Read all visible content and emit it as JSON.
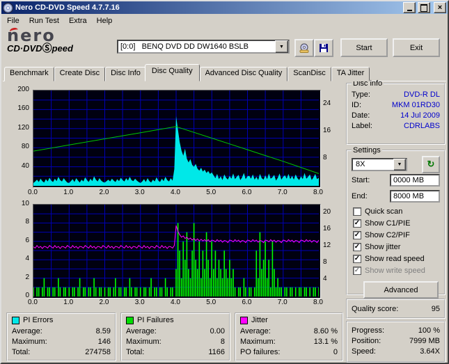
{
  "icons": {
    "close": "×",
    "dropdown": "▼",
    "refresh": "↻",
    "check": "✓"
  },
  "window": {
    "title": "Nero CD-DVD Speed 4.7.7.16"
  },
  "menu": {
    "items": [
      "File",
      "Run Test",
      "Extra",
      "Help"
    ]
  },
  "brand": {
    "logo_top": "nero",
    "logo_bottom_left": "CD·DVD",
    "logo_s": "Ⓢ",
    "logo_bottom_right": "peed"
  },
  "toolbar": {
    "drive": "[0:0]   BENQ DVD DD DW1640 BSLB",
    "start": "Start",
    "exit": "Exit"
  },
  "tabs": {
    "items": [
      "Benchmark",
      "Create Disc",
      "Disc Info",
      "Disc Quality",
      "Advanced Disc Quality",
      "ScanDisc",
      "TA Jitter"
    ],
    "active_index": 3
  },
  "disc_info": {
    "title": "Disc info",
    "rows": [
      {
        "label": "Type:",
        "value": "DVD-R DL"
      },
      {
        "label": "ID:",
        "value": "MKM 01RD30"
      },
      {
        "label": "Date:",
        "value": "14 Jul 2009"
      },
      {
        "label": "Label:",
        "value": "CDRLABS"
      }
    ]
  },
  "settings": {
    "title": "Settings",
    "speed": "8X",
    "start_label": "Start:",
    "start_value": "0000 MB",
    "end_label": "End:",
    "end_value": "8000 MB",
    "checkboxes": [
      {
        "label": "Quick scan",
        "checked": false,
        "enabled": true
      },
      {
        "label": "Show C1/PIE",
        "checked": true,
        "enabled": true
      },
      {
        "label": "Show C2/PIF",
        "checked": true,
        "enabled": true
      },
      {
        "label": "Show jitter",
        "checked": true,
        "enabled": true
      },
      {
        "label": "Show read speed",
        "checked": true,
        "enabled": true
      },
      {
        "label": "Show write speed",
        "checked": true,
        "enabled": false
      }
    ],
    "advanced": "Advanced"
  },
  "quality": {
    "label": "Quality score:",
    "value": "95"
  },
  "progress": {
    "rows": [
      {
        "label": "Progress:",
        "value": "100 %"
      },
      {
        "label": "Position:",
        "value": "7999 MB"
      },
      {
        "label": "Speed:",
        "value": "3.64X"
      }
    ]
  },
  "stats": [
    {
      "title": "PI Errors",
      "color": "#00e8e8",
      "rows": [
        [
          "Average:",
          "8.59"
        ],
        [
          "Maximum:",
          "146"
        ],
        [
          "Total:",
          "274758"
        ]
      ]
    },
    {
      "title": "PI Failures",
      "color": "#00dd00",
      "rows": [
        [
          "Average:",
          "0.00"
        ],
        [
          "Maximum:",
          "8"
        ],
        [
          "Total:",
          "1166"
        ]
      ]
    },
    {
      "title": "Jitter",
      "color": "#ff00ff",
      "rows": [
        [
          "Average:",
          "8.60 %"
        ],
        [
          "Maximum:",
          "13.1 %"
        ],
        [
          "PO failures:",
          "0"
        ]
      ]
    }
  ],
  "chart_data": [
    {
      "type": "area",
      "title": "PI Errors vs disc position (GB) with read speed overlay",
      "x_min": 0,
      "x_max": 8,
      "x_tick_labels": [
        "0.0",
        "1.0",
        "2.0",
        "3.0",
        "4.0",
        "5.0",
        "6.0",
        "7.0",
        "8.0"
      ],
      "left_axis": {
        "max": 200,
        "ticks": [
          200,
          160,
          120,
          80,
          40
        ]
      },
      "right_axis": {
        "max": 28,
        "ticks": [
          24,
          16,
          8
        ]
      },
      "grid": {
        "v_divs": 16,
        "h_divs": 10
      },
      "series": [
        {
          "name": "PI Errors",
          "type": "area",
          "axis": "left",
          "color": "#00e8e8",
          "values": [
            6,
            9,
            13,
            8,
            15,
            10,
            7,
            14,
            9,
            17,
            11,
            8,
            15,
            10,
            19,
            12,
            9,
            16,
            11,
            7,
            6,
            10,
            14,
            8,
            16,
            11,
            7,
            13,
            9,
            18,
            12,
            8,
            15,
            10,
            20,
            13,
            9,
            16,
            11,
            8,
            7,
            10,
            13,
            9,
            15,
            11,
            8,
            14,
            10,
            17,
            12,
            9,
            16,
            11,
            19,
            12,
            10,
            15,
            11,
            8,
            6,
            9,
            14,
            8,
            16,
            10,
            7,
            13,
            9,
            18,
            11,
            8,
            15,
            10,
            19,
            12,
            9,
            16,
            11,
            35,
            146,
            118,
            92,
            74,
            63,
            78,
            57,
            49,
            56,
            44,
            40,
            46,
            36,
            32,
            38,
            30,
            34,
            27,
            31,
            25,
            28,
            22,
            16,
            25,
            14,
            20,
            12,
            24,
            17,
            13,
            21,
            15,
            26,
            14,
            19,
            23,
            12,
            18,
            27,
            14,
            20,
            21,
            15,
            24,
            13,
            19,
            12,
            25,
            16,
            13,
            22,
            14,
            26,
            15,
            18,
            23,
            11,
            17,
            26,
            13,
            19,
            22,
            15,
            25,
            14,
            21,
            13,
            24,
            16,
            12,
            20,
            14,
            27,
            15,
            19,
            24,
            12,
            18,
            25,
            14,
            17
          ]
        },
        {
          "name": "Read speed",
          "type": "line",
          "axis": "right",
          "color": "#00c800",
          "values": [
            10.2,
            11.1,
            12.0,
            12.9,
            13.8,
            14.7,
            15.6,
            16.5,
            17.4,
            15.7,
            14.0,
            12.3,
            10.6,
            8.9,
            7.2,
            5.4,
            3.6
          ]
        }
      ]
    },
    {
      "type": "bar",
      "title": "PI Failures (bars) and Jitter (line) vs disc position (GB)",
      "x_min": 0,
      "x_max": 8,
      "x_tick_labels": [
        "0.0",
        "1.0",
        "2.0",
        "3.0",
        "4.0",
        "5.0",
        "6.0",
        "7.0",
        "8.0"
      ],
      "left_axis": {
        "max": 10,
        "ticks": [
          10,
          8,
          6,
          4,
          2,
          0
        ]
      },
      "right_axis": {
        "max": 22,
        "ticks": [
          20,
          16,
          12,
          8,
          4
        ]
      },
      "grid": {
        "v_divs": 16,
        "h_divs": 10
      },
      "series": [
        {
          "name": "PI Failures",
          "type": "bar",
          "axis": "left",
          "color": "#00ff00",
          "values": [
            1,
            0,
            1,
            1,
            0,
            1,
            2,
            0,
            1,
            1,
            0,
            1,
            1,
            0,
            2,
            1,
            0,
            1,
            1,
            0,
            1,
            0,
            1,
            1,
            0,
            1,
            2,
            0,
            1,
            1,
            0,
            1,
            1,
            0,
            2,
            1,
            0,
            1,
            1,
            0,
            1,
            0,
            1,
            1,
            0,
            1,
            2,
            0,
            1,
            1,
            0,
            1,
            1,
            0,
            2,
            1,
            0,
            1,
            1,
            0,
            1,
            0,
            1,
            1,
            0,
            1,
            2,
            0,
            1,
            1,
            0,
            1,
            1,
            0,
            2,
            1,
            0,
            1,
            1,
            0,
            3,
            8,
            5,
            2,
            6,
            4,
            7,
            3,
            2,
            5,
            8,
            4,
            3,
            6,
            2,
            5,
            3,
            7,
            4,
            2,
            6,
            3,
            5,
            2,
            4,
            3,
            2,
            5,
            3,
            2,
            4,
            2,
            3,
            1,
            0,
            1,
            1,
            0,
            2,
            1,
            0,
            1,
            1,
            0,
            1,
            5,
            2,
            7,
            3,
            4,
            6,
            2,
            4,
            1,
            6,
            3,
            1,
            2,
            1,
            1,
            0,
            1,
            1,
            0,
            1,
            1,
            0,
            1,
            0,
            1,
            1,
            0,
            1,
            1,
            0,
            1,
            0,
            1,
            1,
            0,
            1
          ]
        },
        {
          "name": "Jitter",
          "type": "line",
          "axis": "right",
          "color": "#ff00ff",
          "values": [
            11.9,
            11.6,
            12.2,
            11.7,
            12.0,
            11.5,
            12.0,
            11.9,
            11.6,
            12.2,
            11.9,
            11.6,
            12.2,
            11.7,
            12.0,
            11.5,
            12.0,
            11.9,
            11.6,
            12.2,
            11.9,
            11.6,
            12.2,
            11.7,
            12.0,
            11.5,
            12.0,
            11.9,
            11.6,
            12.2,
            11.9,
            11.6,
            12.2,
            11.7,
            12.0,
            11.5,
            12.0,
            11.9,
            11.6,
            12.2,
            11.9,
            11.6,
            12.2,
            11.7,
            12.0,
            11.5,
            12.0,
            11.9,
            11.6,
            12.2,
            11.9,
            11.6,
            12.2,
            11.7,
            12.0,
            11.5,
            12.0,
            11.9,
            11.6,
            12.2,
            11.9,
            11.6,
            12.2,
            11.7,
            12.0,
            11.5,
            12.0,
            11.9,
            11.6,
            12.2,
            11.9,
            11.6,
            12.2,
            11.7,
            12.0,
            11.5,
            12.0,
            11.9,
            11.6,
            12.2,
            17.0,
            15.6,
            14.8,
            14.2,
            14.5,
            13.9,
            14.2,
            13.7,
            14.0,
            13.5,
            13.9,
            13.4,
            13.8,
            13.3,
            13.7,
            13.3,
            13.6,
            13.2,
            13.6,
            13.1,
            13.5,
            13.4,
            13.1,
            13.6,
            13.2,
            13.5,
            13.0,
            13.4,
            13.3,
            12.9,
            13.5,
            13.4,
            13.1,
            13.6,
            13.2,
            13.5,
            13.0,
            13.4,
            13.3,
            12.9,
            13.5,
            13.4,
            13.1,
            13.6,
            13.2,
            13.5,
            13.0,
            13.4,
            13.3,
            12.9,
            13.5,
            13.4,
            13.1,
            13.6,
            13.2,
            13.5,
            13.0,
            13.4,
            13.3,
            12.9,
            13.5,
            13.4,
            13.1,
            13.6,
            13.2,
            13.5,
            13.0,
            13.4,
            13.3,
            12.9,
            13.5,
            13.4,
            13.1,
            13.6,
            13.2,
            13.5,
            13.0,
            13.4,
            13.3,
            12.9,
            13.5
          ]
        }
      ]
    }
  ]
}
